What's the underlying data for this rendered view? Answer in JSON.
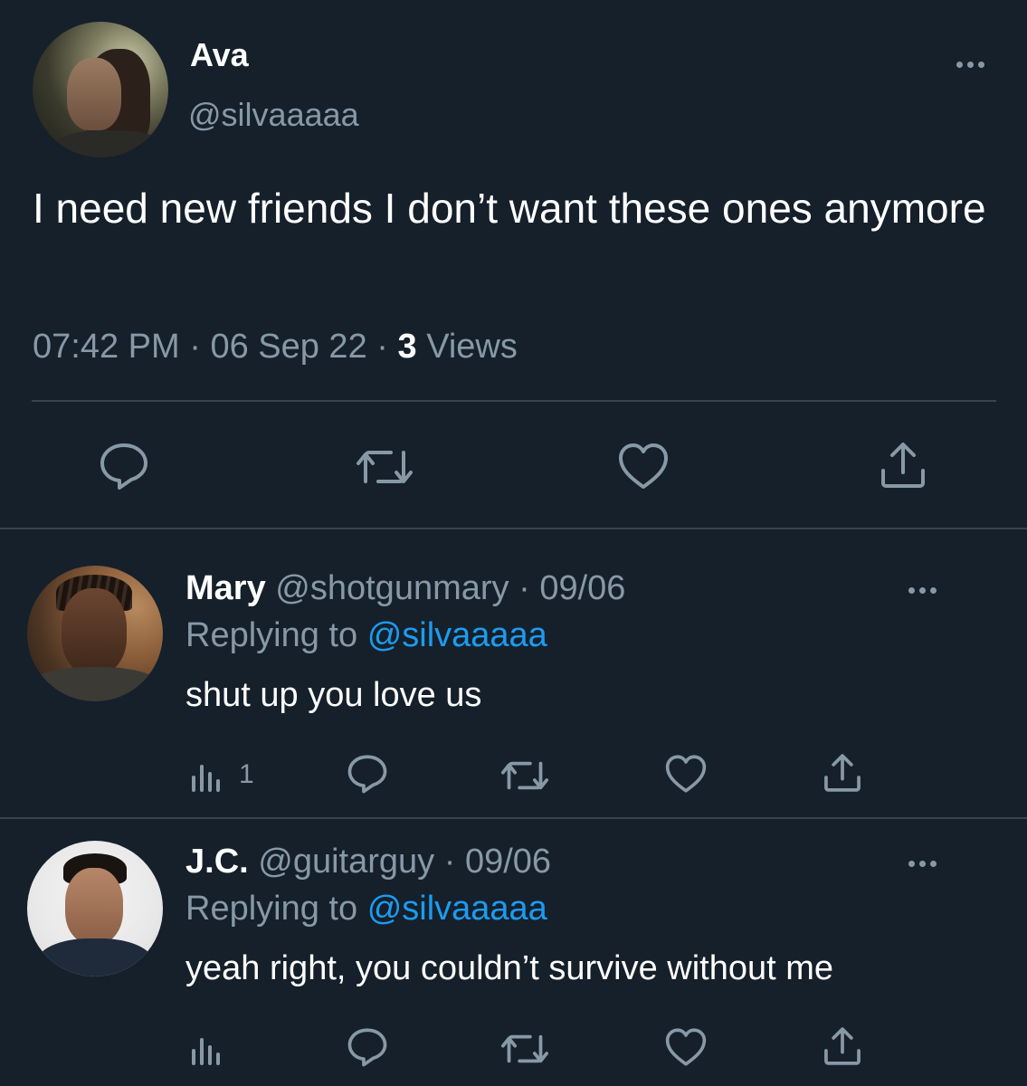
{
  "main_tweet": {
    "author_name": "Ava",
    "author_handle": "@silvaaaaa",
    "text": "I need new friends I don’t want these ones anymore",
    "time": "07:42 PM",
    "date": "06 Sep 22",
    "views_count": "3",
    "views_label": "Views",
    "actions": [
      "reply-icon",
      "retweet-icon",
      "like-icon",
      "share-icon"
    ]
  },
  "replies": [
    {
      "name": "Mary",
      "handle": "@shotgunmary",
      "date": "09/06",
      "replying_prefix": "Replying to",
      "replying_to": "@silvaaaaa",
      "text": "shut up you love us",
      "views": "1"
    },
    {
      "name": "J.C.",
      "handle": "@guitarguy",
      "date": "09/06",
      "replying_prefix": "Replying to",
      "replying_to": "@silvaaaaa",
      "text": "yeah right, you couldn’t survive without me",
      "views": ""
    }
  ],
  "colors": {
    "background": "#15202b",
    "secondary_text": "#8899a6",
    "mention": "#1d9bf0",
    "divider": "#38444d"
  }
}
